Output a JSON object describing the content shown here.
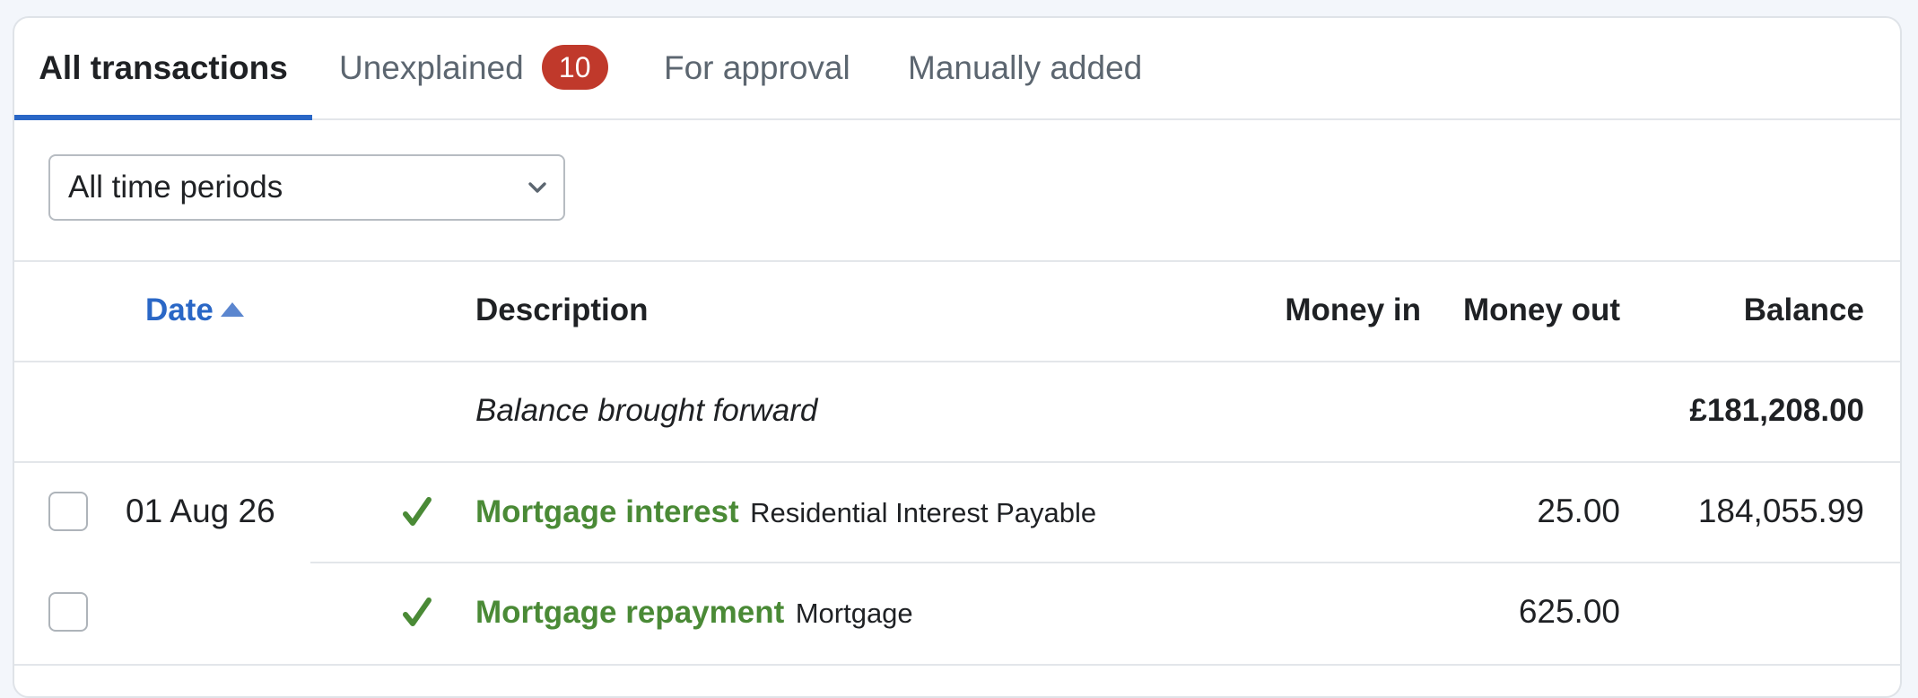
{
  "tabs": {
    "all": "All transactions",
    "unexplained": "Unexplained",
    "unexplained_count": "10",
    "approval": "For approval",
    "manual": "Manually added"
  },
  "filter": {
    "period": "All time periods"
  },
  "table": {
    "headers": {
      "date": "Date",
      "description": "Description",
      "money_in": "Money in",
      "money_out": "Money out",
      "balance": "Balance"
    },
    "brought_forward": {
      "label": "Balance brought forward",
      "balance": "£181,208.00"
    },
    "rows": [
      {
        "date": "01 Aug 26",
        "title": "Mortgage interest",
        "category": "Residential Interest Payable",
        "money_in": "",
        "money_out": "25.00",
        "balance": "184,055.99"
      },
      {
        "date": "",
        "title": "Mortgage repayment",
        "category": "Mortgage",
        "money_in": "",
        "money_out": "625.00",
        "balance": ""
      }
    ]
  },
  "colors": {
    "accent": "#2a67c6",
    "badge": "#c0392b",
    "explained_green": "#4a8a36"
  },
  "icons": {
    "sort": "sort-ascending-icon",
    "select": "chevron-down-icon",
    "explained": "check-icon"
  }
}
